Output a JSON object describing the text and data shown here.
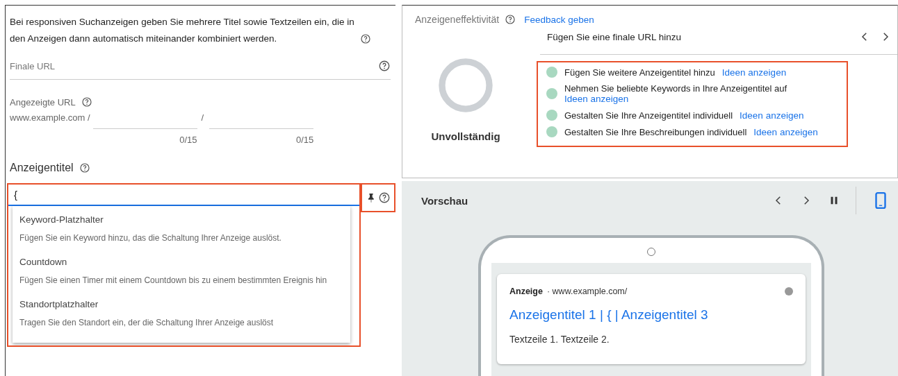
{
  "editor": {
    "intro": "Bei responsiven Suchanzeigen geben Sie mehrere Titel sowie Textzeilen ein, die in den Anzeigen dann automatisch miteinander kombiniert werden.",
    "final_url": {
      "placeholder": "Finale URL"
    },
    "display_url": {
      "label": "Angezeigte URL",
      "domain": "www.example.com /",
      "separator": "/",
      "paths": [
        {
          "counter": "0/15"
        },
        {
          "counter": "0/15"
        }
      ]
    },
    "headlines": {
      "heading": "Anzeigentitel",
      "field": {
        "value": "{",
        "focused": true,
        "highlighted": true
      },
      "tools_highlighted": true,
      "suggestions": [
        {
          "title": "Keyword-Platzhalter",
          "description": "Fügen Sie ein Keyword hinzu, das die Schaltung Ihrer Anzeige auslöst."
        },
        {
          "title": "Countdown",
          "description": "Fügen Sie einen Timer mit einem Countdown bis zu einem bestimmten Ereignis hin"
        },
        {
          "title": "Standortplatzhalter",
          "description": "Tragen Sie den Standort ein, der die Schaltung Ihrer Anzeige auslöst"
        }
      ]
    }
  },
  "effectiveness": {
    "title": "Anzeigeneffektivität",
    "feedback_link": "Feedback geben",
    "rating": "Unvollständig",
    "current_tip": "Fügen Sie eine finale URL hinzu",
    "highlighted": true,
    "tips": [
      {
        "text": "Fügen Sie weitere Anzeigentitel hinzu",
        "link": "Ideen anzeigen",
        "color": "#a8d8c0"
      },
      {
        "text": "Nehmen Sie beliebte Keywords in Ihre Anzeigentitel auf",
        "link": "Ideen anzeigen",
        "color": "#a8d8c0"
      },
      {
        "text": "Gestalten Sie Ihre Anzeigentitel individuell",
        "link": "Ideen anzeigen",
        "color": "#a8d8c0"
      },
      {
        "text": "Gestalten Sie Ihre Beschreibungen individuell",
        "link": "Ideen anzeigen",
        "color": "#a8d8c0"
      }
    ]
  },
  "preview": {
    "title": "Vorschau",
    "playing": true,
    "device": {
      "selected": true
    },
    "ad": {
      "badge": "Anzeige",
      "url": "· www.example.com/",
      "headline": "Anzeigentitel 1 | { | Anzeigentitel 3",
      "description": "Textzeile 1. Textzeile 2."
    }
  }
}
